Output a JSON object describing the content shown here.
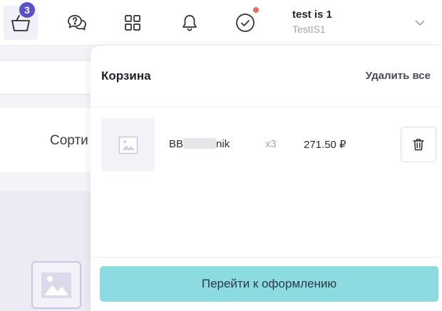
{
  "topbar": {
    "cart": {
      "icon": "basket-icon",
      "badge": "3"
    },
    "support": {
      "icon": "chat-question-icon"
    },
    "apps": {
      "icon": "grid-icon"
    },
    "notifications": {
      "icon": "bell-icon"
    },
    "tasks": {
      "icon": "check-circle-icon",
      "indicator_color": "#ec6a5e"
    },
    "user": {
      "name": "test is 1",
      "login": "TestIS1",
      "menu_icon": "chevron-down-icon"
    }
  },
  "background_page": {
    "sort_label": "Сорти",
    "image_placeholder_icon": "image-icon"
  },
  "cart_drawer": {
    "title": "Корзина",
    "clear_all_label": "Удалить все",
    "items": [
      {
        "name_prefix": "BB",
        "name_suffix": "nik",
        "quantity": "x3",
        "price": "271.50 ₽",
        "thumb_icon": "image-icon",
        "delete_icon": "trash-icon"
      }
    ],
    "checkout_label": "Перейти к оформлению"
  },
  "colors": {
    "accent": "#5b4fce",
    "checkout_button": "#8cdbe0",
    "notification_dot": "#ec6a5e",
    "background": "#f4f4f8"
  }
}
